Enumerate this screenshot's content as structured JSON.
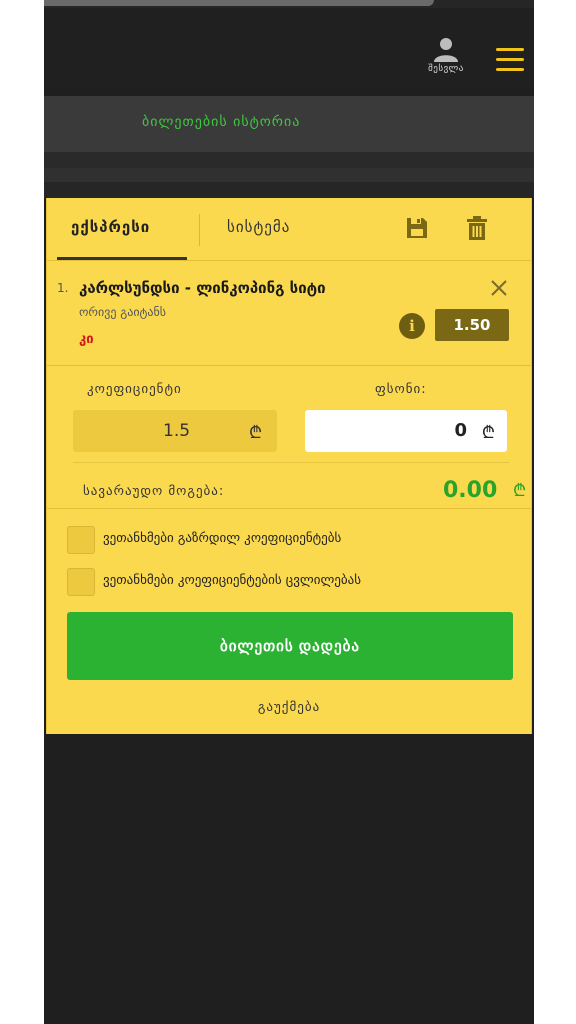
{
  "header": {
    "login_label": "შესვლა",
    "accent": "#f0c419"
  },
  "history_link": "ბილეთების ისტორია",
  "slip": {
    "tabs": [
      {
        "label": "ექსპრესი",
        "active": true
      },
      {
        "label": "სისტემა",
        "active": false
      }
    ],
    "bet": {
      "number": "1.",
      "match": "კარლსუნდსი - ლინკოპინგ სიტი",
      "market": "ორივე გაიტანს",
      "selection": "კი",
      "odd": "1.50"
    },
    "coef_label": "კოეფიციენტი",
    "stake_label": "ფსონი:",
    "coef_value": "1.5",
    "stake_value": "0",
    "currency": "₾",
    "win_label": "სავარაუდო მოგება:",
    "win_value": "0.00",
    "checks": [
      "ვეთანხმები გაზრდილ კოეფიციენტებს",
      "ვეთანხმები კოეფიციენტების ცვლილებას"
    ],
    "place_button": "ბილეთის დადება",
    "cancel": "გაუქმება"
  }
}
